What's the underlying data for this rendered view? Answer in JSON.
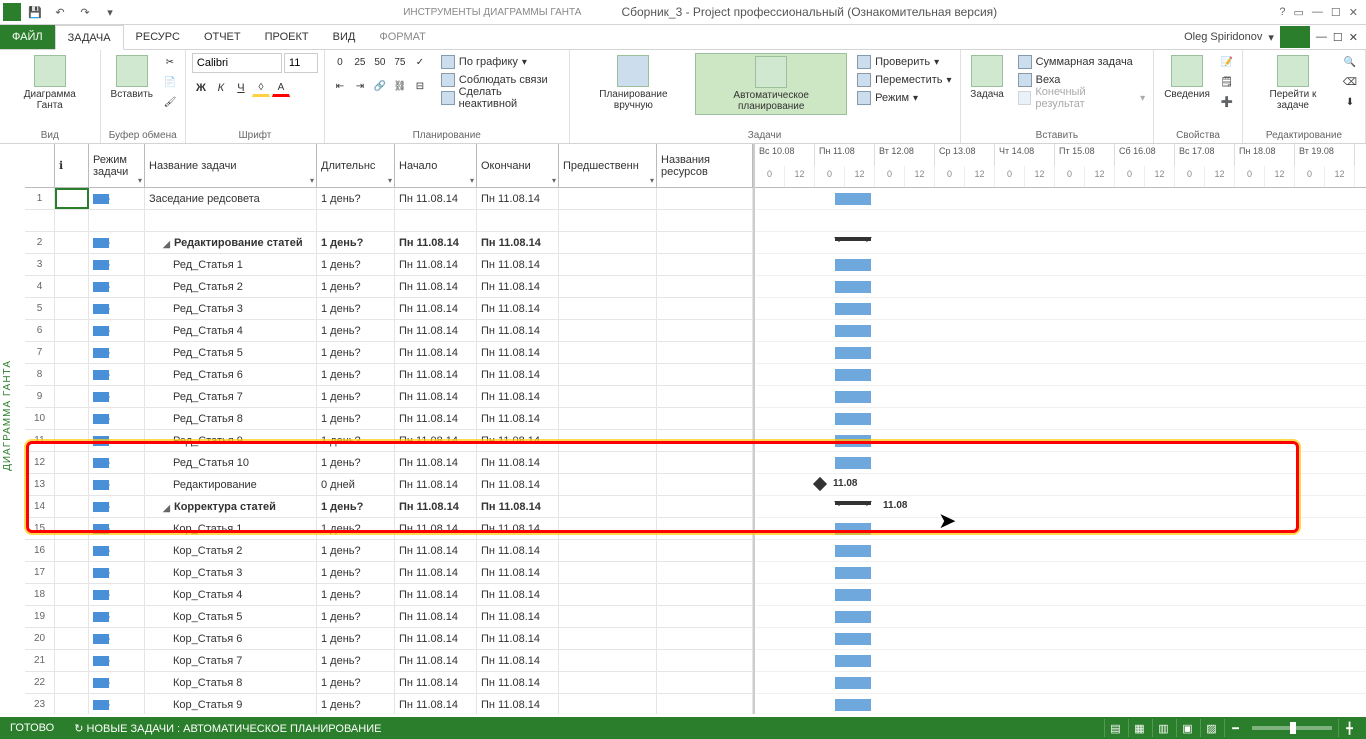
{
  "window": {
    "tool_tab": "ИНСТРУМЕНТЫ ДИАГРАММЫ ГАНТА",
    "title": "Сборник_3 - Project профессиональный (Ознакомительная версия)",
    "help": "?",
    "user": "Oleg Spiridonov"
  },
  "menu": {
    "file": "ФАЙЛ",
    "task": "ЗАДАЧА",
    "resource": "РЕСУРС",
    "report": "ОТЧЕТ",
    "project": "ПРОЕКТ",
    "view": "ВИД",
    "format": "ФОРМАТ"
  },
  "ribbon": {
    "view_btn": "Диаграмма Ганта",
    "paste": "Вставить",
    "font_name": "Calibri",
    "font_size": "11",
    "clipboard": "Буфер обмена",
    "font": "Шрифт",
    "planning": "Планирование",
    "plan_item1": "По графику",
    "plan_item2": "Соблюдать связи",
    "plan_item3": "Сделать неактивной",
    "sched_manual": "Планирование вручную",
    "sched_auto": "Автоматическое планирование",
    "tasks": "Задачи",
    "task_check": "Проверить",
    "task_move": "Переместить",
    "task_mode": "Режим",
    "insert_task": "Задача",
    "insert_summary": "Суммарная задача",
    "insert_milestone": "Веха",
    "insert_deliverable": "Конечный результат",
    "insert": "Вставить",
    "info": "Сведения",
    "props": "Свойства",
    "goto": "Перейти к задаче",
    "editing": "Редактирование"
  },
  "view_label": "ДИАГРАММА ГАНТА",
  "columns": {
    "info": "",
    "mode": "Режим задачи",
    "name": "Название задачи",
    "duration": "Длительнс",
    "start": "Начало",
    "finish": "Окончани",
    "predecessors": "Предшественн",
    "resources": "Названия ресурсов"
  },
  "timeline_days": [
    "Вс 10.08",
    "Пн 11.08",
    "Вт 12.08",
    "Ср 13.08",
    "Чт 14.08",
    "Пт 15.08",
    "Сб 16.08",
    "Вс 17.08",
    "Пн 18.08",
    "Вт 19.08"
  ],
  "timeline_hours": [
    "0",
    "12"
  ],
  "rows": [
    {
      "n": "1",
      "name": "Заседание редсовета",
      "dur": "1 день?",
      "start": "Пн 11.08.14",
      "fin": "Пн 11.08.14",
      "ind": 0,
      "bold": false,
      "sel": true
    },
    {
      "n": "",
      "name": "",
      "dur": "",
      "start": "",
      "fin": "",
      "ind": 0,
      "blank": true
    },
    {
      "n": "2",
      "name": "Редактирование статей",
      "dur": "1 день?",
      "start": "Пн 11.08.14",
      "fin": "Пн 11.08.14",
      "ind": 0,
      "bold": true,
      "sum": true
    },
    {
      "n": "3",
      "name": "Ред_Статья 1",
      "dur": "1 день?",
      "start": "Пн 11.08.14",
      "fin": "Пн 11.08.14",
      "ind": 1
    },
    {
      "n": "4",
      "name": "Ред_Статья 2",
      "dur": "1 день?",
      "start": "Пн 11.08.14",
      "fin": "Пн 11.08.14",
      "ind": 1
    },
    {
      "n": "5",
      "name": "Ред_Статья 3",
      "dur": "1 день?",
      "start": "Пн 11.08.14",
      "fin": "Пн 11.08.14",
      "ind": 1
    },
    {
      "n": "6",
      "name": "Ред_Статья 4",
      "dur": "1 день?",
      "start": "Пн 11.08.14",
      "fin": "Пн 11.08.14",
      "ind": 1
    },
    {
      "n": "7",
      "name": "Ред_Статья 5",
      "dur": "1 день?",
      "start": "Пн 11.08.14",
      "fin": "Пн 11.08.14",
      "ind": 1
    },
    {
      "n": "8",
      "name": "Ред_Статья 6",
      "dur": "1 день?",
      "start": "Пн 11.08.14",
      "fin": "Пн 11.08.14",
      "ind": 1
    },
    {
      "n": "9",
      "name": "Ред_Статья 7",
      "dur": "1 день?",
      "start": "Пн 11.08.14",
      "fin": "Пн 11.08.14",
      "ind": 1
    },
    {
      "n": "10",
      "name": "Ред_Статья 8",
      "dur": "1 день?",
      "start": "Пн 11.08.14",
      "fin": "Пн 11.08.14",
      "ind": 1
    },
    {
      "n": "11",
      "name": "Ред_Статья 9",
      "dur": "1 день?",
      "start": "Пн 11.08.14",
      "fin": "Пн 11.08.14",
      "ind": 1
    },
    {
      "n": "12",
      "name": "Ред_Статья 10",
      "dur": "1 день?",
      "start": "Пн 11.08.14",
      "fin": "Пн 11.08.14",
      "ind": 1
    },
    {
      "n": "13",
      "name": "Редактирование",
      "dur": "0 дней",
      "start": "Пн 11.08.14",
      "fin": "Пн 11.08.14",
      "ind": 1,
      "ms": true,
      "ms_label": "11.08"
    },
    {
      "n": "14",
      "name": "Корректура статей",
      "dur": "1 день?",
      "start": "Пн 11.08.14",
      "fin": "Пн 11.08.14",
      "ind": 0,
      "bold": true,
      "sum": true,
      "ms_label": "11.08"
    },
    {
      "n": "15",
      "name": "Кор_Статья 1",
      "dur": "1 день?",
      "start": "Пн 11.08.14",
      "fin": "Пн 11.08.14",
      "ind": 1
    },
    {
      "n": "16",
      "name": "Кор_Статья 2",
      "dur": "1 день?",
      "start": "Пн 11.08.14",
      "fin": "Пн 11.08.14",
      "ind": 1
    },
    {
      "n": "17",
      "name": "Кор_Статья 3",
      "dur": "1 день?",
      "start": "Пн 11.08.14",
      "fin": "Пн 11.08.14",
      "ind": 1
    },
    {
      "n": "18",
      "name": "Кор_Статья 4",
      "dur": "1 день?",
      "start": "Пн 11.08.14",
      "fin": "Пн 11.08.14",
      "ind": 1
    },
    {
      "n": "19",
      "name": "Кор_Статья 5",
      "dur": "1 день?",
      "start": "Пн 11.08.14",
      "fin": "Пн 11.08.14",
      "ind": 1
    },
    {
      "n": "20",
      "name": "Кор_Статья 6",
      "dur": "1 день?",
      "start": "Пн 11.08.14",
      "fin": "Пн 11.08.14",
      "ind": 1
    },
    {
      "n": "21",
      "name": "Кор_Статья 7",
      "dur": "1 день?",
      "start": "Пн 11.08.14",
      "fin": "Пн 11.08.14",
      "ind": 1
    },
    {
      "n": "22",
      "name": "Кор_Статья 8",
      "dur": "1 день?",
      "start": "Пн 11.08.14",
      "fin": "Пн 11.08.14",
      "ind": 1
    },
    {
      "n": "23",
      "name": "Кор_Статья 9",
      "dur": "1 день?",
      "start": "Пн 11.08.14",
      "fin": "Пн 11.08.14",
      "ind": 1
    }
  ],
  "statusbar": {
    "ready": "ГОТОВО",
    "new_tasks": "НОВЫЕ ЗАДАЧИ : АВТОМАТИЧЕСКОЕ ПЛАНИРОВАНИЕ"
  }
}
